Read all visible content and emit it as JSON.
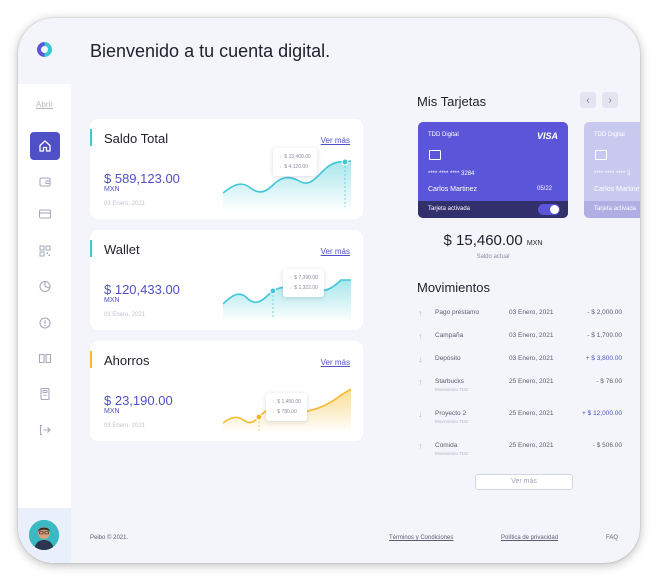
{
  "header": {
    "welcome": "Bienvenido a tu cuenta digital."
  },
  "sidebar": {
    "open_label": "Abrir",
    "items": [
      {
        "icon": "home-icon",
        "active": true
      },
      {
        "icon": "wallet-icon"
      },
      {
        "icon": "card-icon"
      },
      {
        "icon": "qr-icon"
      },
      {
        "icon": "pie-chart-icon"
      },
      {
        "icon": "alert-icon"
      },
      {
        "icon": "book-icon"
      },
      {
        "icon": "calculator-icon"
      },
      {
        "icon": "logout-icon"
      }
    ]
  },
  "accounts": [
    {
      "title": "Saldo Total",
      "link": "Ver más",
      "amount": "$ 589,123.00",
      "currency": "MXN",
      "date": "03 Enero, 2021",
      "accent": "#3ec8d6",
      "tip_up": "$ 13,400.00",
      "tip_down": "$ 4,120.00"
    },
    {
      "title": "Wallet",
      "link": "Ver más",
      "amount": "$ 120,433.00",
      "currency": "MXN",
      "date": "03 Enero, 2021",
      "accent": "#3ec8d6",
      "tip_up": "$ 7,390.00",
      "tip_down": "$ 1,322.00"
    },
    {
      "title": "Ahorros",
      "link": "Ver más",
      "amount": "$ 23,190.00",
      "currency": "MXN",
      "date": "03 Enero, 2021",
      "accent": "#f6b92b",
      "tip_up": "$ 1,450.00",
      "tip_down": "$ 780.00"
    }
  ],
  "cards": {
    "title": "Mis Tarjetas",
    "prev": "‹",
    "next": "›",
    "main": {
      "name": "TDD Digital",
      "brand": "VISA",
      "number": "**** **** **** 3284",
      "holder": "Carlos Martinez",
      "exp": "05/22",
      "status": "Tarjeta activada"
    },
    "ghost": {
      "name": "TDD Digital",
      "number": "**** **** **** 3",
      "holder": "Carlos Martine",
      "status": "Tarjeta activada"
    },
    "balance": "$ 15,460.00",
    "balance_currency": "MXN",
    "balance_label": "Saldo actual"
  },
  "movements": {
    "title": "Movimientos",
    "rows": [
      {
        "dir": "up",
        "desc": "Pago préstamo",
        "sub": "",
        "date": "03 Enero, 2021",
        "amount": "- $ 2,000.00",
        "positive": false
      },
      {
        "dir": "up",
        "desc": "Campaña",
        "sub": "",
        "date": "03 Enero, 2021",
        "amount": "- $ 1,700.00",
        "positive": false
      },
      {
        "dir": "down",
        "desc": "Depósito",
        "sub": "",
        "date": "03 Enero, 2021",
        "amount": "+ $ 3,800.00",
        "positive": true
      },
      {
        "dir": "up",
        "desc": "Starbucks",
        "sub": "Movimiento TDD",
        "date": "25 Enero, 2021",
        "amount": "- $ 76.00",
        "positive": false
      },
      {
        "dir": "down",
        "desc": "Proyecto 2",
        "sub": "Movimiento TDD",
        "date": "25 Enero, 2021",
        "amount": "+ $ 12,000.00",
        "positive": true
      },
      {
        "dir": "up",
        "desc": "Comida",
        "sub": "Movimiento TDD",
        "date": "25 Enero, 2021",
        "amount": "- $ 506.00",
        "positive": false
      }
    ],
    "more": "Ver más"
  },
  "footer": {
    "copyright": "Peibo © 2021.",
    "terms": "Términos y Condiciones",
    "privacy": "Política de privacidad",
    "faq": "FAQ"
  }
}
